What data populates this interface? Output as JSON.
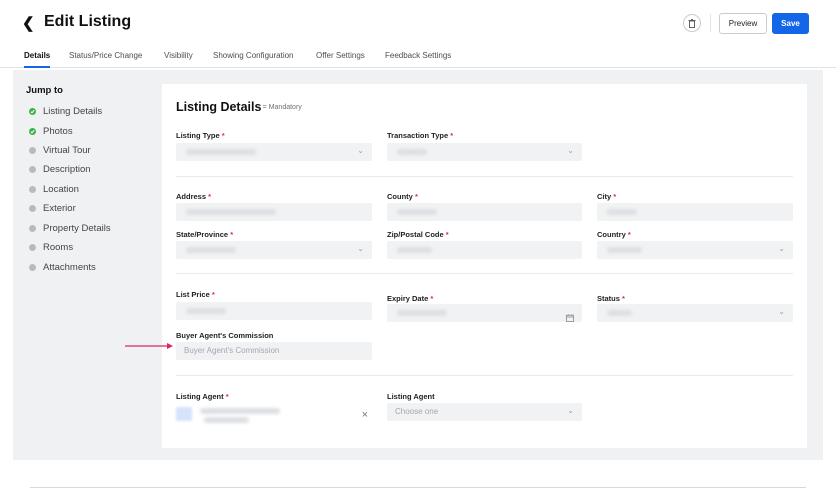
{
  "header": {
    "back_icon": "chevron-left-icon",
    "title": "Edit Listing",
    "trash_icon": "trash-icon",
    "preview_label": "Preview",
    "save_label": "Save",
    "save_color": "#1565e8"
  },
  "tabs": [
    {
      "label": "Details",
      "active": true
    },
    {
      "label": "Status/Price Change"
    },
    {
      "label": "Visibility"
    },
    {
      "label": "Showing Configuration"
    },
    {
      "label": "Offer Settings"
    },
    {
      "label": "Feedback Settings"
    }
  ],
  "jump": {
    "title": "Jump to",
    "items": [
      {
        "label": "Listing Details",
        "done": true
      },
      {
        "label": "Photos",
        "done": true
      },
      {
        "label": "Virtual Tour"
      },
      {
        "label": "Description"
      },
      {
        "label": "Location"
      },
      {
        "label": "Exterior"
      },
      {
        "label": "Property Details"
      },
      {
        "label": "Rooms"
      },
      {
        "label": "Attachments"
      }
    ]
  },
  "form": {
    "title": "Listing Details",
    "mandatory_note": "* = Mandatory",
    "required_marker": "*",
    "listing_type": "Listing Type",
    "transaction_type": "Transaction Type",
    "address": "Address",
    "county": "County",
    "city": "City",
    "state": "State/Province",
    "zip": "Zip/Postal Code",
    "country": "Country",
    "list_price": "List Price",
    "expiry_date": "Expiry Date",
    "status": "Status",
    "buyer_commission": "Buyer Agent's Commission",
    "buyer_commission_placeholder": "Buyer Agent's Commission",
    "listing_agent": "Listing Agent",
    "listing_agent_2": "Listing Agent",
    "choose_one": "Choose one",
    "accent_red": "#e0245e"
  }
}
